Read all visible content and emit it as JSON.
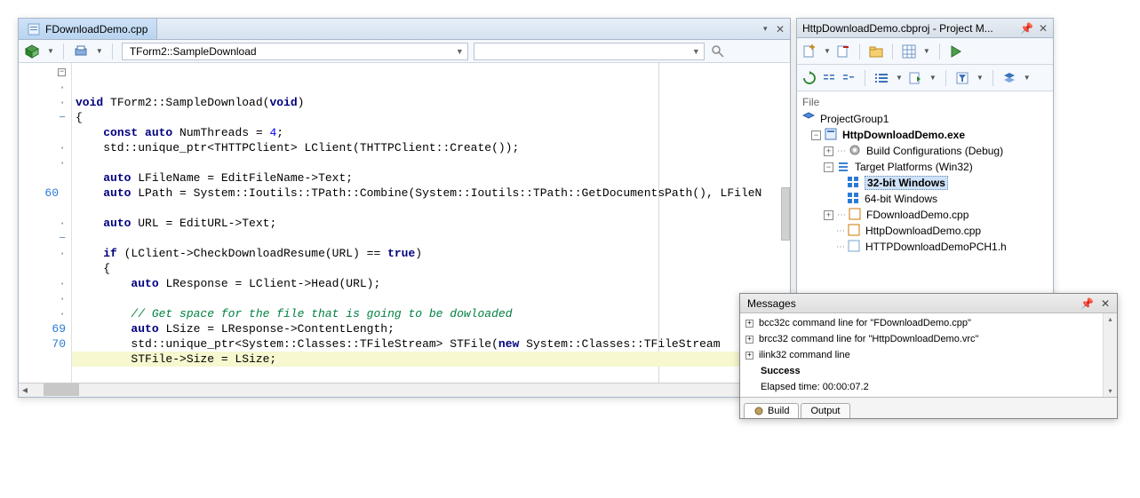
{
  "editor": {
    "tab_label": "FDownloadDemo.cpp",
    "method_dropdown": "TForm2::SampleDownload",
    "right_dropdown": "",
    "gutter": {
      "line_60": "60",
      "line_69": "69",
      "line_70": "70"
    },
    "code_lines": [
      {
        "html": "<span class='kw'>void</span> TForm2::SampleDownload(<span class='kw'>void</span>)"
      },
      {
        "html": "{"
      },
      {
        "html": "    <span class='kw'>const auto</span> NumThreads = <span class='num'>4</span>;"
      },
      {
        "html": "    std::unique_ptr&lt;THTTPClient&gt; LClient(THTTPClient::Create());"
      },
      {
        "html": ""
      },
      {
        "html": "    <span class='kw'>auto</span> LFileName = EditFileName-&gt;Text;"
      },
      {
        "html": "    <span class='kw'>auto</span> LPath = System::Ioutils::TPath::Combine(System::Ioutils::TPath::GetDocumentsPath(), LFileN"
      },
      {
        "html": ""
      },
      {
        "html": "    <span class='kw'>auto</span> URL = EditURL-&gt;Text;"
      },
      {
        "html": ""
      },
      {
        "html": "    <span class='kw'>if</span> (LClient-&gt;CheckDownloadResume(URL) == <span class='kw'>true</span>)"
      },
      {
        "html": "    {"
      },
      {
        "html": "        <span class='kw'>auto</span> LResponse = LClient-&gt;Head(URL);"
      },
      {
        "html": ""
      },
      {
        "html": "        <span class='cm'>// Get space for the file that is going to be dowloaded</span>"
      },
      {
        "html": "        <span class='kw'>auto</span> LSize = LResponse-&gt;ContentLength;"
      },
      {
        "html": "        std::unique_ptr&lt;System::Classes::TFileStream&gt; STFile(<span class='kw'>new</span> System::Classes::TFileStream"
      },
      {
        "html": "        STFile-&gt;Size = LSize;",
        "hl": true
      },
      {
        "html": ""
      }
    ]
  },
  "project_panel": {
    "title": "HttpDownloadDemo.cbproj - Project M...",
    "file_label": "File",
    "root": "ProjectGroup1",
    "exe": "HttpDownloadDemo.exe",
    "build_cfg": "Build Configurations (Debug)",
    "targets": "Target Platforms (Win32)",
    "target32": "32-bit Windows",
    "target64": "64-bit Windows",
    "src1": "FDownloadDemo.cpp",
    "src2": "HttpDownloadDemo.cpp",
    "src3": "HTTPDownloadDemoPCH1.h"
  },
  "messages": {
    "title": "Messages",
    "lines": [
      "bcc32c command line for \"FDownloadDemo.cpp\"",
      "brcc32 command line for \"HttpDownloadDemo.vrc\"",
      "ilink32 command line",
      "Success",
      "Elapsed time: 00:00:07.2"
    ],
    "tab_build": "Build",
    "tab_output": "Output"
  }
}
